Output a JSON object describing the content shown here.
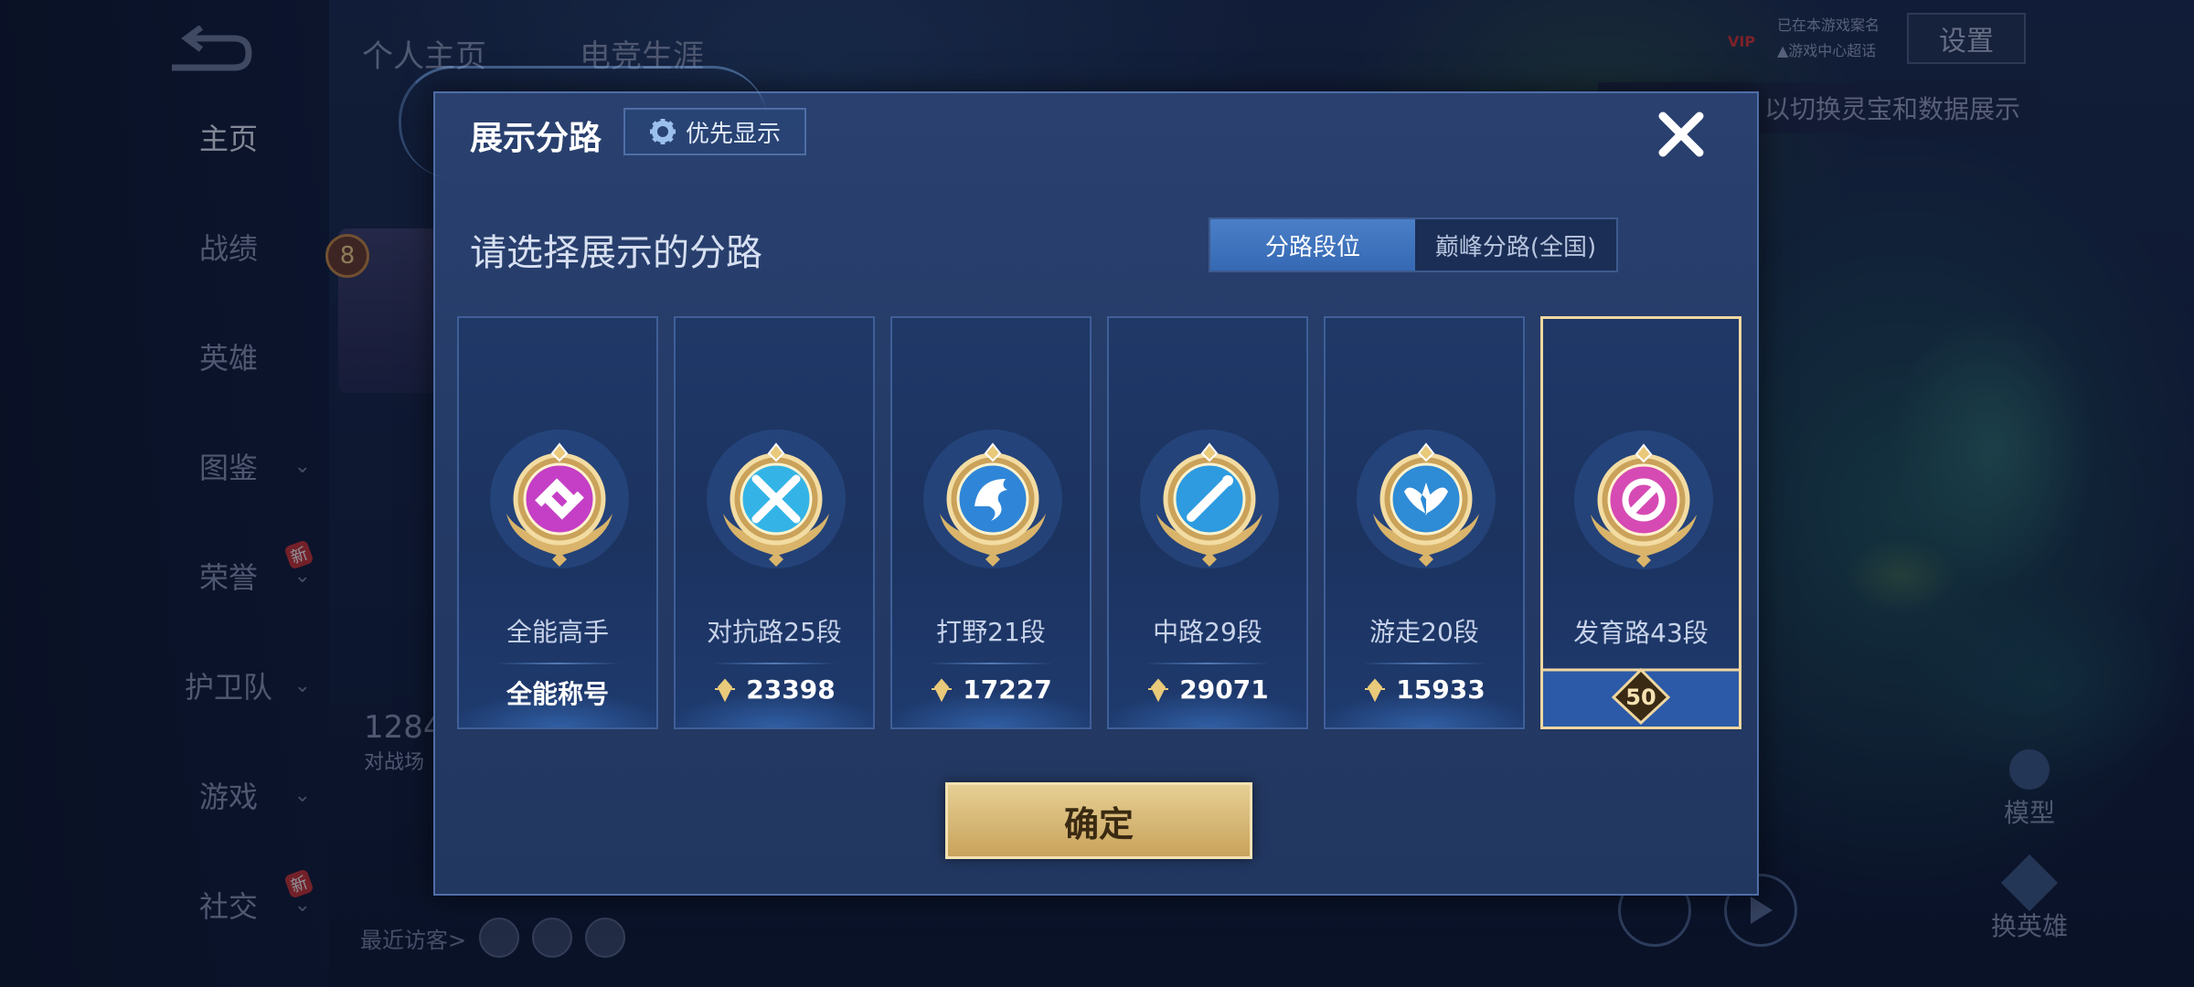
{
  "nav": {
    "items": [
      {
        "label": "主页",
        "active": true,
        "has_chevron": false,
        "new": false
      },
      {
        "label": "战绩",
        "active": false,
        "has_chevron": false,
        "new": false
      },
      {
        "label": "英雄",
        "active": false,
        "has_chevron": false,
        "new": false
      },
      {
        "label": "图鉴",
        "active": false,
        "has_chevron": true,
        "new": false
      },
      {
        "label": "荣誉",
        "active": false,
        "has_chevron": true,
        "new": true
      },
      {
        "label": "护卫队",
        "active": false,
        "has_chevron": true,
        "new": false
      },
      {
        "label": "游戏",
        "active": false,
        "has_chevron": true,
        "new": false
      },
      {
        "label": "社交",
        "active": false,
        "has_chevron": true,
        "new": true
      }
    ],
    "new_badge": "新"
  },
  "top_tabs": [
    "个人主页",
    "电竞生涯"
  ],
  "settings_label": "设置",
  "hint_text": "以切换灵宝和数据展示",
  "vip": {
    "tag": "VIP",
    "line1": "已在本游戏案名",
    "line2": "▲游戏中心超话"
  },
  "profile": {
    "level": "8",
    "stat_value": "1284",
    "stat_label": "对战场"
  },
  "recent_visitors_label": "最近访客>",
  "side_buttons": {
    "model": "模型",
    "change_hero": "换英雄"
  },
  "modal": {
    "title": "展示分路",
    "priority_label": "优先显示",
    "subtitle": "请选择展示的分路",
    "tabs": [
      {
        "label": "分路段位",
        "active": true
      },
      {
        "label": "巅峰分路(全国)",
        "active": false
      }
    ],
    "cards": [
      {
        "name": "全能高手",
        "value": "全能称号",
        "show_gem": false,
        "selected": false,
        "badge_color": "#c43fc6",
        "emblem": "allround"
      },
      {
        "name": "对抗路25段",
        "value": "23398",
        "show_gem": true,
        "selected": false,
        "badge_color": "#34b4e6",
        "emblem": "sword"
      },
      {
        "name": "打野21段",
        "value": "17227",
        "show_gem": true,
        "selected": false,
        "badge_color": "#2f86d8",
        "emblem": "dragon"
      },
      {
        "name": "中路29段",
        "value": "29071",
        "show_gem": true,
        "selected": false,
        "badge_color": "#2e9be0",
        "emblem": "wand"
      },
      {
        "name": "游走20段",
        "value": "15933",
        "show_gem": true,
        "selected": false,
        "badge_color": "#2e8bd6",
        "emblem": "wings"
      },
      {
        "name": "发育路43段",
        "value": "50",
        "show_gem": false,
        "selected": true,
        "badge_color": "#d64ab4",
        "emblem": "arrow"
      }
    ],
    "confirm_label": "确定"
  },
  "colors": {
    "gold": "#e6cf94",
    "modal_bg": "#243a66",
    "tab_active": "#3669b3",
    "selected_border": "#f0d7a0"
  }
}
